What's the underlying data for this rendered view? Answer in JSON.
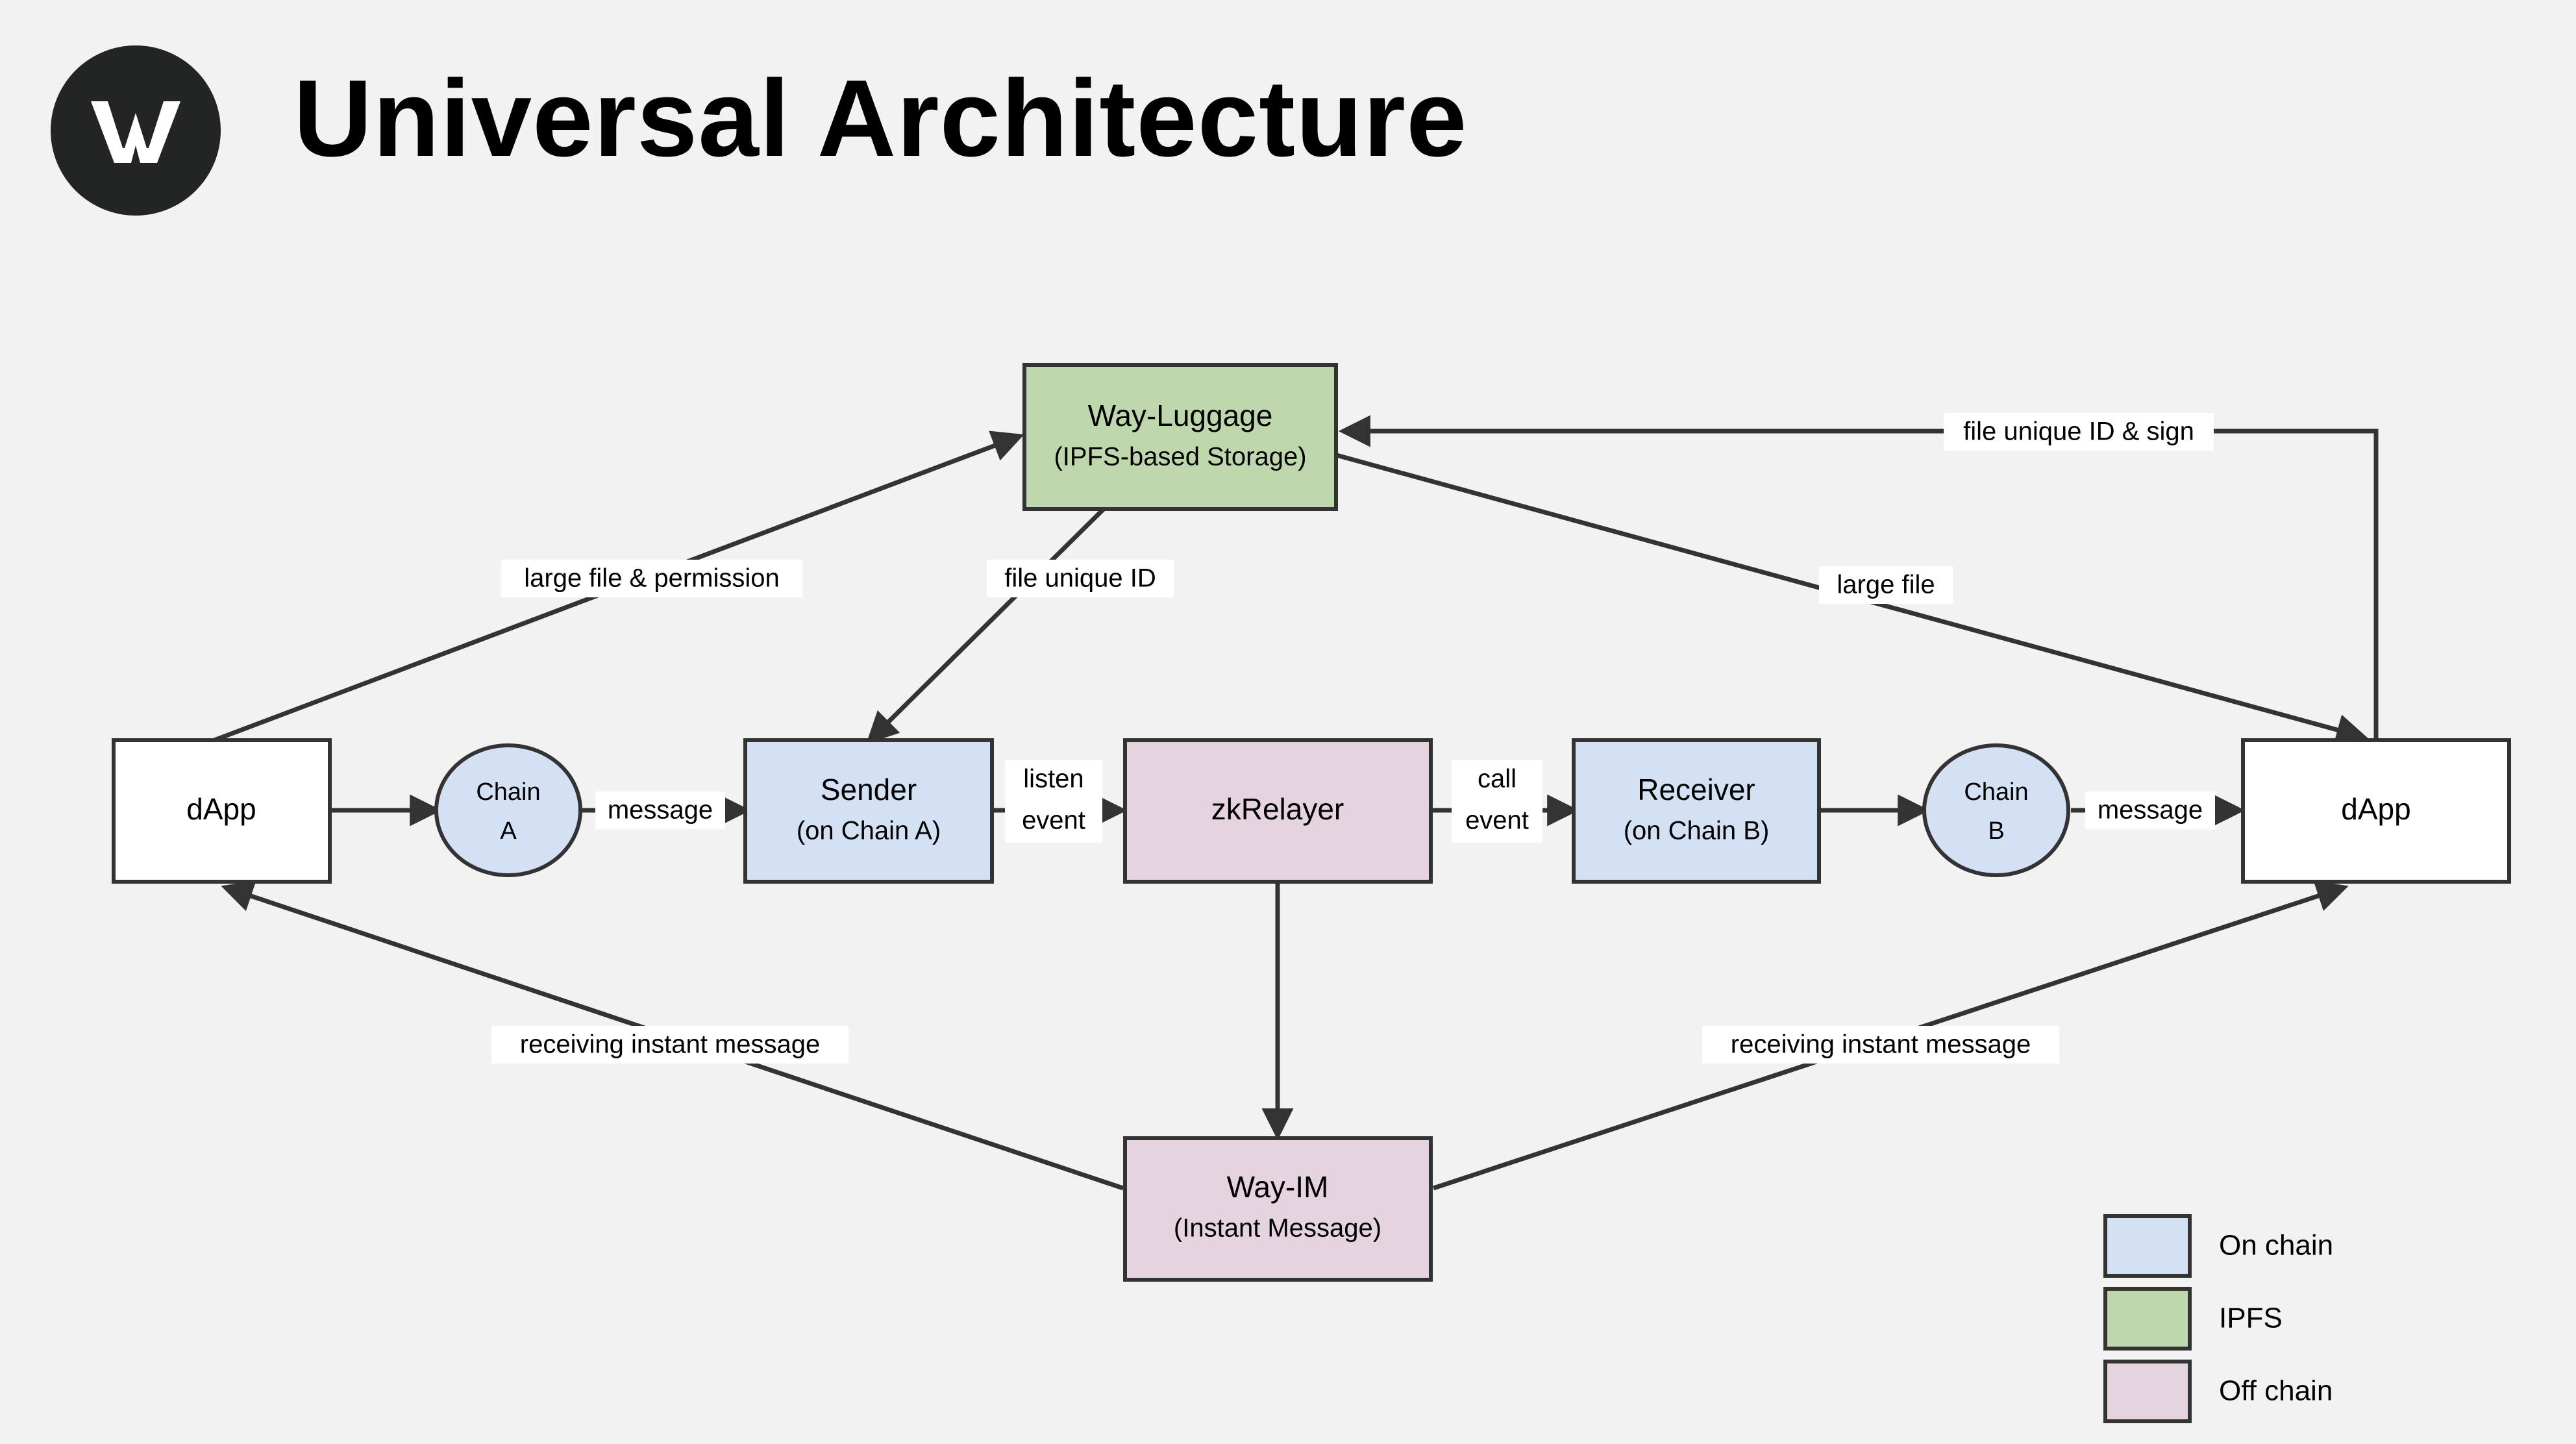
{
  "header": {
    "title": "Universal Architecture",
    "logo_letter": "W",
    "logo_bg_color": "#232524",
    "logo_fg_color": "#ffffff"
  },
  "colors": {
    "background": "#f2f2f2",
    "on_chain": "#d4e1f5",
    "ipfs": "#bed7ad",
    "off_chain": "#e5d3e0",
    "plain": "#ffffff",
    "stroke": "#333333"
  },
  "nodes": {
    "dapp_left": {
      "label": "dApp"
    },
    "chain_a": {
      "line1": "Chain",
      "line2": "A"
    },
    "sender": {
      "line1": "Sender",
      "line2": "(on Chain A)"
    },
    "zkrelayer": {
      "label": "zkRelayer"
    },
    "receiver": {
      "line1": "Receiver",
      "line2": "(on Chain B)"
    },
    "chain_b": {
      "line1": "Chain",
      "line2": "B"
    },
    "dapp_right": {
      "label": "dApp"
    },
    "way_luggage": {
      "line1": "Way-Luggage",
      "line2": "(IPFS-based Storage)"
    },
    "way_im": {
      "line1": "Way-IM",
      "line2": "(Instant Message)"
    }
  },
  "edge_labels": {
    "large_file_permission": "large file & permission",
    "file_unique_id": "file unique ID",
    "file_unique_id_sign": "file unique ID & sign",
    "large_file": "large file",
    "message_left": "message",
    "listen_event_l1": "listen",
    "listen_event_l2": "event",
    "call_event_l1": "call",
    "call_event_l2": "event",
    "message_right": "message",
    "receiving_instant_message_left": "receiving instant message",
    "receiving_instant_message_right": "receiving instant message"
  },
  "legend": {
    "items": [
      {
        "label": "On chain",
        "color": "#d4e1f5"
      },
      {
        "label": "IPFS",
        "color": "#bed7ad"
      },
      {
        "label": "Off chain",
        "color": "#e5d3e0"
      }
    ]
  }
}
